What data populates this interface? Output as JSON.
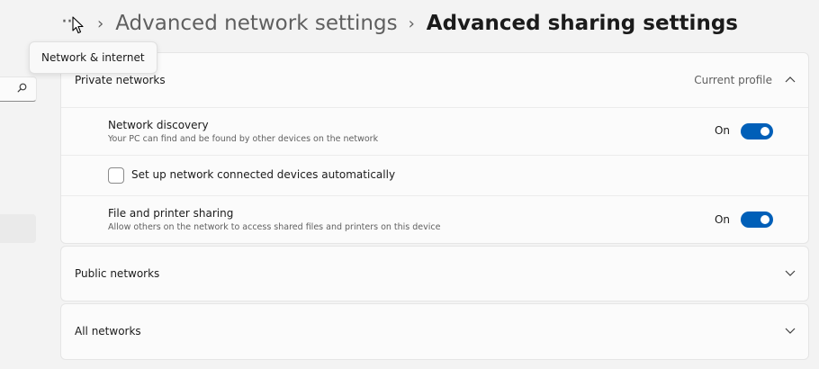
{
  "header": {
    "ellipsis": "···",
    "crumb_previous": "Advanced network settings",
    "crumb_current": "Advanced sharing settings",
    "separator_icon": "chevron-right-icon"
  },
  "tooltip": {
    "text": "Network & internet"
  },
  "nav": {
    "search_icon": "search-icon"
  },
  "private_networks": {
    "title": "Private networks",
    "profile_label": "Current profile",
    "expanded": true,
    "network_discovery": {
      "title": "Network discovery",
      "description": "Your PC can find and be found by other devices on the network",
      "state_label": "On",
      "on": true
    },
    "auto_setup": {
      "label": "Set up network connected devices automatically",
      "checked": false
    },
    "file_printer_sharing": {
      "title": "File and printer sharing",
      "description": "Allow others on the network to access shared files and printers on this device",
      "state_label": "On",
      "on": true
    }
  },
  "public_networks": {
    "title": "Public networks",
    "expanded": false
  },
  "all_networks": {
    "title": "All networks",
    "expanded": false
  },
  "colors": {
    "accent": "#005fb8",
    "background": "#f3f3f3",
    "card": "#fbfbfb",
    "text_secondary": "#5f5f5f"
  }
}
